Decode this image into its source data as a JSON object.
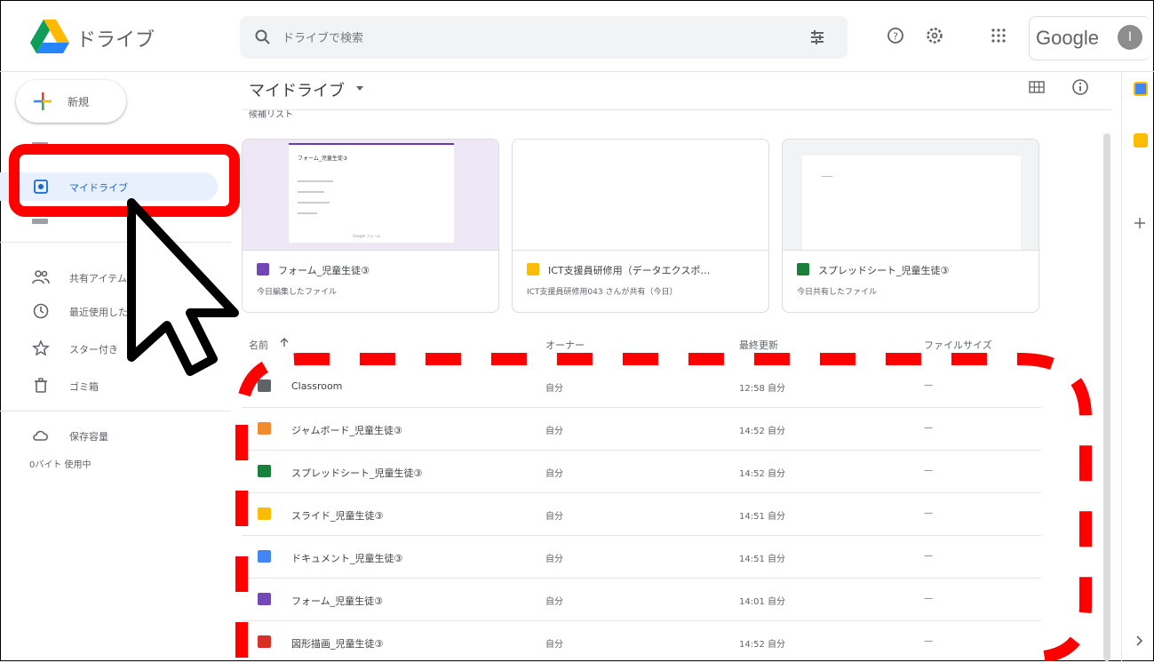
{
  "header": {
    "app_title": "ドライブ",
    "search_placeholder": "ドライブで検索",
    "google_label": "Google",
    "avatar_letter": "I"
  },
  "sidebar": {
    "new_label": "新規",
    "items": [
      {
        "label": "マイドライブ",
        "icon": "my-drive-icon"
      },
      {
        "label": "共有アイテム",
        "icon": "shared-icon"
      },
      {
        "label": "最近使用したアイテム",
        "icon": "recent-icon"
      },
      {
        "label": "スター付き",
        "icon": "star-icon"
      },
      {
        "label": "ゴミ箱",
        "icon": "trash-icon"
      },
      {
        "label": "保存容量",
        "icon": "cloud-icon"
      }
    ],
    "storage_text": "0バイト 使用中"
  },
  "main": {
    "breadcrumb": "マイドライブ",
    "sub_label": "候補リスト",
    "cards": [
      {
        "name": "フォーム_児童生徒③",
        "sub": "今日編集したファイル",
        "icon": "forms-icon",
        "thumb_title": "フォーム_児童生徒③",
        "thumb_footer": "Google フォーム"
      },
      {
        "name": "ICT支援員研修用（データエクスポ…",
        "sub": "ICT支援員研修用043 さんが共有（今日）",
        "icon": "slides-icon"
      },
      {
        "name": "スプレッドシート_児童生徒③",
        "sub": "今日共有したファイル",
        "icon": "sheets-icon",
        "thumb_title": "――"
      }
    ],
    "columns": {
      "name": "名前",
      "owner": "オーナー",
      "modified": "最終更新",
      "size": "ファイルサイズ"
    },
    "files": [
      {
        "name": "Classroom",
        "owner": "自分",
        "modified": "12:58 自分",
        "size": "—",
        "icon": "folder-icon"
      },
      {
        "name": "ジャムボード_児童生徒③",
        "owner": "自分",
        "modified": "14:52 自分",
        "size": "—",
        "icon": "jamboard-icon"
      },
      {
        "name": "スプレッドシート_児童生徒③",
        "owner": "自分",
        "modified": "14:52 自分",
        "size": "—",
        "icon": "sheets-icon"
      },
      {
        "name": "スライド_児童生徒③",
        "owner": "自分",
        "modified": "14:51 自分",
        "size": "—",
        "icon": "slides-icon"
      },
      {
        "name": "ドキュメント_児童生徒③",
        "owner": "自分",
        "modified": "14:51 自分",
        "size": "—",
        "icon": "docs-icon"
      },
      {
        "name": "フォーム_児童生徒③",
        "owner": "自分",
        "modified": "14:01 自分",
        "size": "—",
        "icon": "forms-icon"
      },
      {
        "name": "図形描画_児童生徒③",
        "owner": "自分",
        "modified": "14:52 自分",
        "size": "—",
        "icon": "drawings-icon"
      }
    ]
  },
  "colors": {
    "annotation_red": "#ff0000",
    "active_blue": "#1967d2",
    "active_bg": "#e8f0fe"
  }
}
